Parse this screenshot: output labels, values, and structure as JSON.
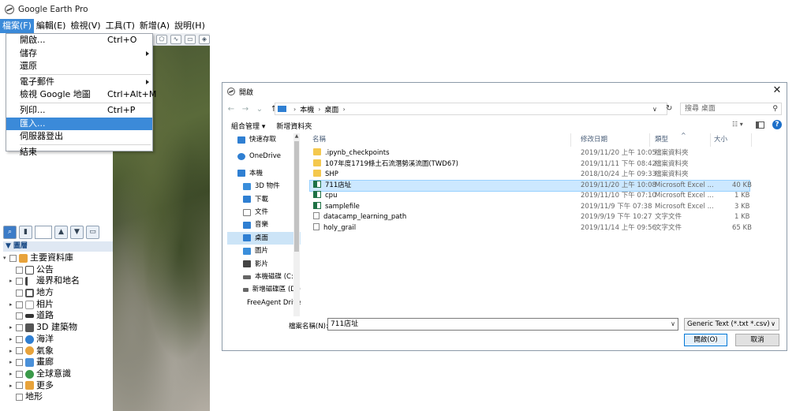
{
  "google_earth": {
    "app_title": "Google Earth Pro",
    "menubar": [
      "檔案(F)",
      "編輯(E)",
      "檢視(V)",
      "工具(T)",
      "新增(A)",
      "說明(H)"
    ],
    "file_menu": [
      {
        "label": "開啟...",
        "shortcut": "Ctrl+O"
      },
      {
        "label": "儲存",
        "shortcut": ""
      },
      {
        "label": "還原",
        "shortcut": ""
      },
      {
        "label": "電子郵件",
        "shortcut": ""
      },
      {
        "label": "檢視 Google 地圖",
        "shortcut": "Ctrl+Alt+M"
      },
      {
        "label": "列印...",
        "shortcut": "Ctrl+P"
      },
      {
        "label": "匯入...",
        "shortcut": ""
      },
      {
        "label": "伺服器登出",
        "shortcut": ""
      },
      {
        "label": "結束",
        "shortcut": ""
      }
    ],
    "layers_header": "▼ 圖層",
    "layers": [
      {
        "label": "主要資料庫",
        "color": "#e8a33b"
      },
      {
        "label": "公告",
        "color": "#444444"
      },
      {
        "label": "邊界和地名",
        "color": "#444444"
      },
      {
        "label": "地方",
        "color": "#555555"
      },
      {
        "label": "相片",
        "color": "#777777"
      },
      {
        "label": "道路",
        "color": "#333333"
      },
      {
        "label": "3D 建築物",
        "color": "#555555"
      },
      {
        "label": "海洋",
        "color": "#2f7fd2"
      },
      {
        "label": "氣象",
        "color": "#e8a33b"
      },
      {
        "label": "畫廊",
        "color": "#4a90d9"
      },
      {
        "label": "全球意識",
        "color": "#3b9a4a"
      },
      {
        "label": "更多",
        "color": "#e8a33b"
      },
      {
        "label": "地形",
        "color": ""
      }
    ]
  },
  "dialog": {
    "title": "開啟",
    "close": "✕",
    "breadcrumb": [
      "本機",
      "桌面"
    ],
    "search_placeholder": "搜尋 桌面",
    "organize": "組合管理 ▾",
    "new_folder": "新增資料夾",
    "nav_items": [
      {
        "label": "快速存取",
        "color": "#2f7fd2"
      },
      {
        "label": "OneDrive",
        "color": "#2f7fd2"
      },
      {
        "label": "本機",
        "color": "#2f7fd2"
      },
      {
        "label": "3D 物件",
        "color": "#3a8edb"
      },
      {
        "label": "下載",
        "color": "#2f7fd2"
      },
      {
        "label": "文件",
        "color": "#777777"
      },
      {
        "label": "音樂",
        "color": "#2f7fd2"
      },
      {
        "label": "桌面",
        "color": "#2f7fd2"
      },
      {
        "label": "圖片",
        "color": "#3a8edb"
      },
      {
        "label": "影片",
        "color": "#444444"
      },
      {
        "label": "本機磁碟 (C:)",
        "color": "#666666"
      },
      {
        "label": "新增磁碟區 (D:)",
        "color": "#666666"
      },
      {
        "label": "FreeAgent Drive",
        "color": "#3b9a4a"
      }
    ],
    "columns": {
      "name": "名稱",
      "date": "修改日期",
      "type": "類型",
      "size": "大小"
    },
    "files": [
      {
        "name": ".ipynb_checkpoints",
        "date": "2019/11/20 上午 10:05",
        "type": "檔案資料夾",
        "size": "",
        "kind": "folder"
      },
      {
        "name": "107年度1719條土石流潛勢溪流圖(TWD67)",
        "date": "2019/11/11 下午 08:42",
        "type": "檔案資料夾",
        "size": "",
        "kind": "folder"
      },
      {
        "name": "SHP",
        "date": "2018/10/24 上午 09:33",
        "type": "檔案資料夾",
        "size": "",
        "kind": "folder"
      },
      {
        "name": "711店址",
        "date": "2019/11/20 上午 10:08",
        "type": "Microsoft Excel ...",
        "size": "40 KB",
        "kind": "excel"
      },
      {
        "name": "cpu",
        "date": "2019/11/10 下午 07:10",
        "type": "Microsoft Excel ...",
        "size": "1 KB",
        "kind": "excel"
      },
      {
        "name": "samplefile",
        "date": "2019/11/9 下午 07:38",
        "type": "Microsoft Excel ...",
        "size": "3 KB",
        "kind": "excel"
      },
      {
        "name": "datacamp_learning_path",
        "date": "2019/9/19 下午 10:27",
        "type": "文字文件",
        "size": "1 KB",
        "kind": "txt"
      },
      {
        "name": "holy_grail",
        "date": "2019/11/14 上午 09:56",
        "type": "文字文件",
        "size": "65 KB",
        "kind": "txt"
      }
    ],
    "filename_label": "檔案名稱(N):",
    "filename_value": "711店址",
    "filter_value": "Generic Text (*.txt *.csv)",
    "open_button": "開啟(O)",
    "cancel_button": "取消"
  }
}
